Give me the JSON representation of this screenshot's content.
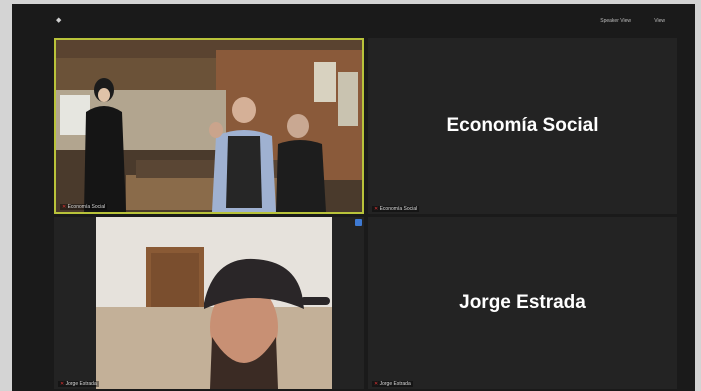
{
  "toolbar": {
    "speaker_view": "Speaker View",
    "view_label": "View"
  },
  "tiles": [
    {
      "name": "Economía Social",
      "video": true
    },
    {
      "name": "Economía Social",
      "video": false
    },
    {
      "name": "Jorge Estrada",
      "video": true
    },
    {
      "name": "Jorge Estrada",
      "video": false
    }
  ],
  "colors": {
    "active_speaker_border": "#b9c33a",
    "background": "#1a1a1a",
    "name_text": "#ffffff"
  }
}
